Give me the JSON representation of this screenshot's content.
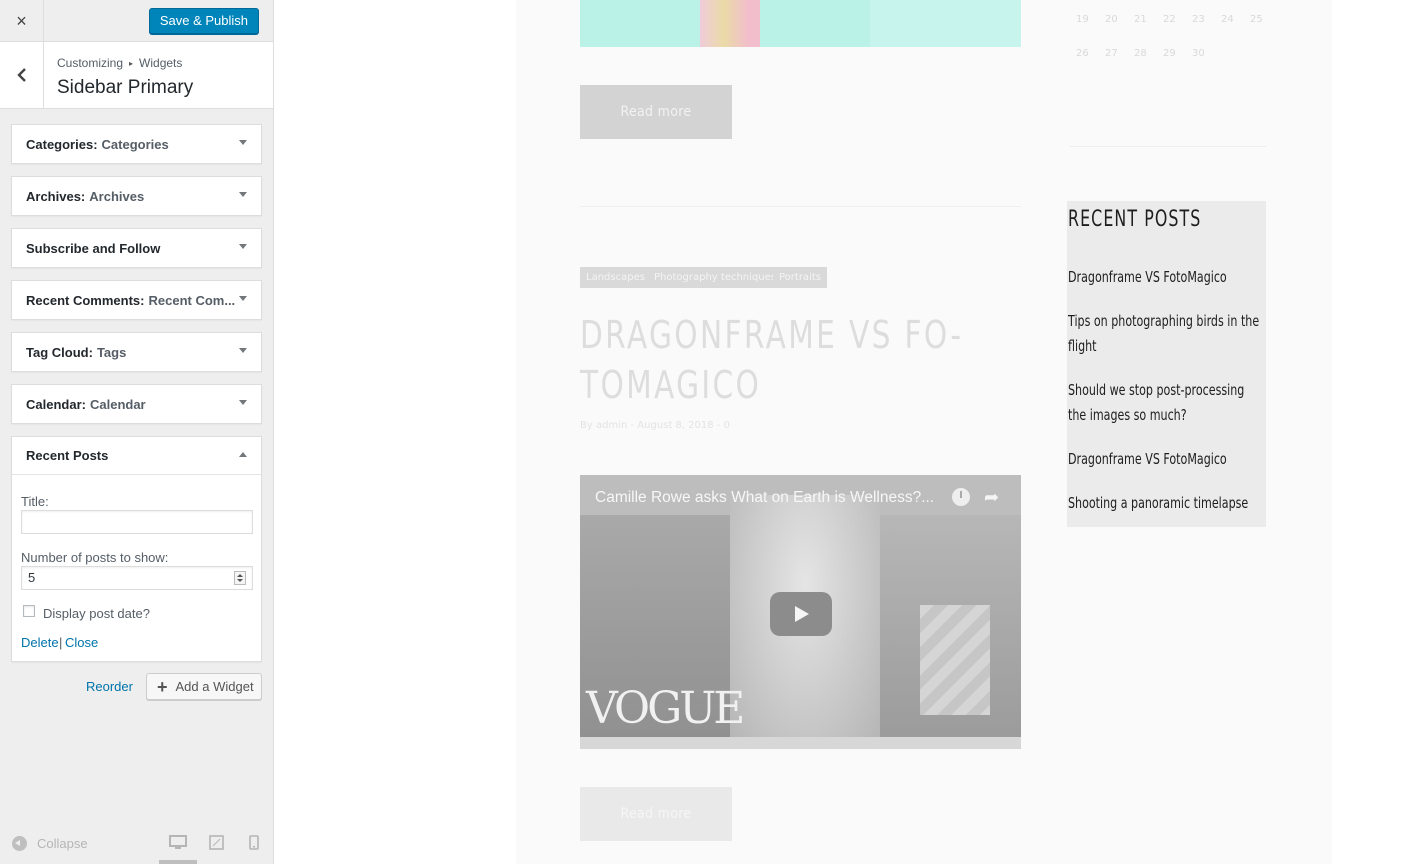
{
  "customizer": {
    "close_label": "×",
    "publish_label": "Save & Publish",
    "breadcrumb": {
      "root": "Customizing",
      "separator": "▸",
      "section": "Widgets"
    },
    "panel_title": "Sidebar Primary",
    "widgets": [
      {
        "name": "Categories",
        "subtitle": "Categories",
        "expanded": false
      },
      {
        "name": "Archives",
        "subtitle": "Archives",
        "expanded": false
      },
      {
        "name": "Subscribe and Follow",
        "subtitle": "",
        "expanded": false
      },
      {
        "name": "Recent Comments",
        "subtitle": "Recent Com...",
        "expanded": false
      },
      {
        "name": "Tag Cloud",
        "subtitle": "Tags",
        "expanded": false
      },
      {
        "name": "Calendar",
        "subtitle": "Calendar",
        "expanded": false
      },
      {
        "name": "Recent Posts",
        "subtitle": "",
        "expanded": true
      }
    ],
    "recent_posts_form": {
      "title_label": "Title:",
      "title_value": "",
      "number_label": "Number of posts to show:",
      "number_value": "5",
      "show_date_label": "Display post date?",
      "show_date_checked": false,
      "delete_label": "Delete",
      "pipe": "|",
      "close_label": "Close"
    },
    "reorder_label": "Reorder",
    "add_widget_label": "Add a Widget",
    "add_widget_icon": "plus-icon",
    "footer": {
      "collapse_label": "Collapse",
      "devices": [
        "desktop",
        "tablet",
        "mobile"
      ],
      "active_device": "desktop"
    },
    "accent_color": "#0085ba",
    "link_color": "#0073aa"
  },
  "preview": {
    "read_more_label": "Read more",
    "calendar_rows": [
      [
        "19",
        "20",
        "21",
        "22",
        "23",
        "24",
        "25"
      ],
      [
        "26",
        "27",
        "28",
        "29",
        "30"
      ]
    ],
    "post": {
      "categories": [
        "Landscapes",
        "Photography techniques",
        "Portraits"
      ],
      "title_line1": "DRAGONFRAME VS FO-",
      "title_line2": "TOMAGICO",
      "meta": "By admin - August 8, 2018 - 0"
    },
    "video": {
      "title": "Camille Rowe asks What on Earth is Wellness?...",
      "logo": "VOGUE"
    },
    "recent_posts": {
      "heading": "RECENT POSTS",
      "items": [
        "Dragonframe VS FotoMagico",
        "Tips on photographing birds in the flight",
        "Should we stop post-processing the images so much?",
        "Dragonframe VS FotoMagico",
        "Shooting a panoramic timelapse"
      ]
    }
  }
}
